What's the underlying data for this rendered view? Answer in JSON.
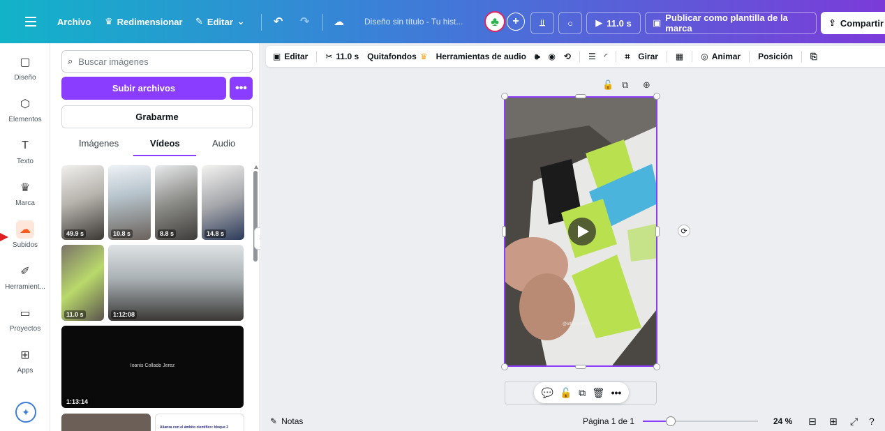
{
  "topbar": {
    "file": "Archivo",
    "resize": "Redimensionar",
    "edit": "Editar",
    "title": "Diseño sin título - Tu hist...",
    "duration": "11.0 s",
    "publish": "Publicar como plantilla de la marca",
    "share": "Compartir"
  },
  "rail": [
    {
      "label": "Diseño",
      "icon": "layout-icon"
    },
    {
      "label": "Elementos",
      "icon": "elements-icon"
    },
    {
      "label": "Texto",
      "icon": "text-icon"
    },
    {
      "label": "Marca",
      "icon": "brand-icon"
    },
    {
      "label": "Subidos",
      "icon": "upload-cloud-icon"
    },
    {
      "label": "Herramient...",
      "icon": "draw-icon"
    },
    {
      "label": "Proyectos",
      "icon": "folder-icon"
    },
    {
      "label": "Apps",
      "icon": "apps-icon"
    }
  ],
  "panel": {
    "search_placeholder": "Buscar imágenes",
    "upload": "Subir archivos",
    "more": "•••",
    "record": "Grabarme",
    "tabs": [
      "Imágenes",
      "Vídeos",
      "Audio"
    ],
    "thumbs": [
      "49.9 s",
      "10.8 s",
      "8.8 s",
      "14.8 s",
      "11.0 s",
      "1:12:08",
      "1:13:14"
    ],
    "wide_caption": "Ioanis Collado Jerez",
    "doc_caption": "Alianza con el ámbito científico: bloque 2"
  },
  "toolbar": {
    "edit": "Editar",
    "trim": "11.0 s",
    "bg_remover": "Quitafondos",
    "audio": "Herramientas de audio",
    "rotate": "Girar",
    "animate": "Animar",
    "position": "Posición"
  },
  "canvas": {
    "watermark": "@eltioncreible"
  },
  "bottom": {
    "notes": "Notas",
    "page": "Página 1 de 1",
    "zoom": "24 %",
    "zoom_level": 0.24
  },
  "colors": {
    "accent": "#8b3dff"
  }
}
